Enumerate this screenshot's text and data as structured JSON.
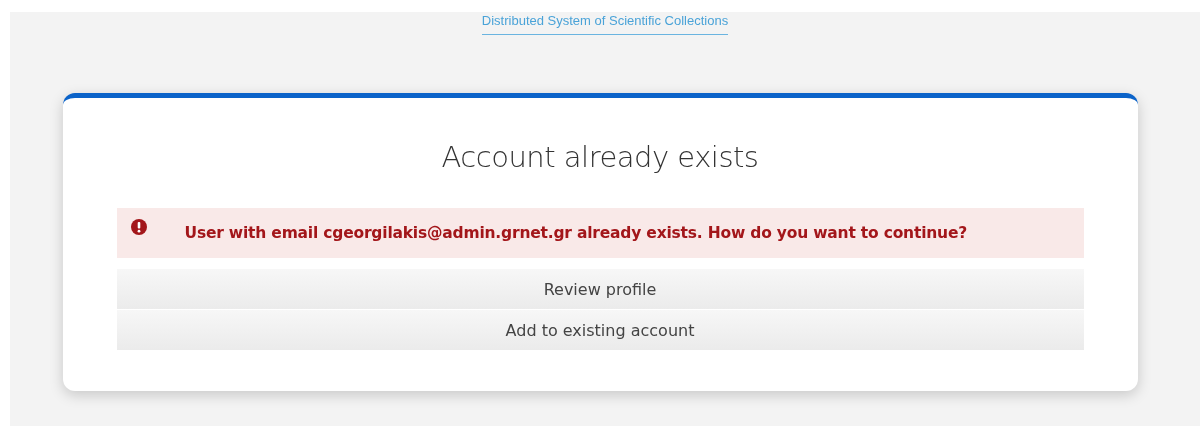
{
  "header": {
    "link": "Distributed System of Scientific Collections"
  },
  "card": {
    "title": "Account already exists",
    "alert": {
      "kind": "error",
      "message": "User with email cgeorgilakis@admin.grnet.gr already exists. How do you want to continue?"
    },
    "buttons": [
      "Review profile",
      "Add to existing account"
    ]
  }
}
